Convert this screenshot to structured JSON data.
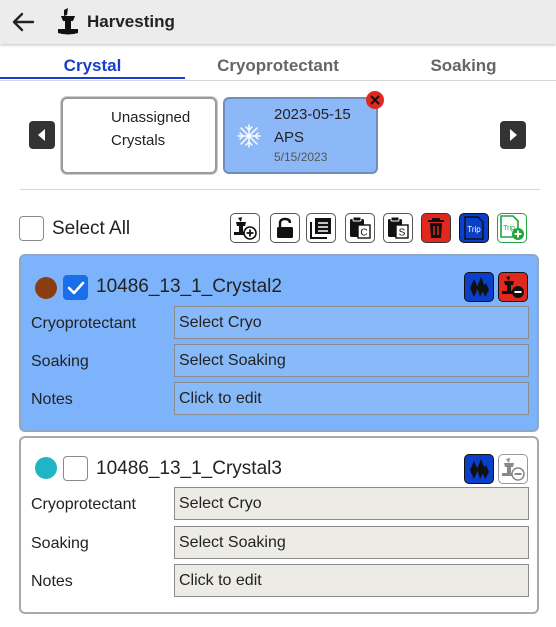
{
  "header": {
    "title": "Harvesting",
    "back_icon": "arrow-left-icon",
    "app_icon": "harvest-tool-icon"
  },
  "tabs": [
    {
      "label": "Crystal",
      "active": true
    },
    {
      "label": "Cryoprotectant",
      "active": false
    },
    {
      "label": "Soaking",
      "active": false
    }
  ],
  "trays": {
    "unassigned": {
      "line1": "Unassigned",
      "line2": "Crystals"
    },
    "selected": {
      "date": "2023-05-15",
      "location": "APS",
      "subdate": "5/15/2023",
      "icon": "snowflake-icon"
    }
  },
  "toolbar": {
    "select_all_label": "Select All",
    "tools": [
      {
        "icon": "harvest-add-icon"
      },
      {
        "icon": "lock-icon"
      },
      {
        "icon": "copy-list-icon"
      },
      {
        "icon": "clipboard-c-icon",
        "text": "C"
      },
      {
        "icon": "clipboard-s-icon",
        "text": "S"
      },
      {
        "icon": "trash-icon"
      },
      {
        "icon": "trip-icon",
        "text": "Trip"
      },
      {
        "icon": "trip-add-icon",
        "text": "Trip"
      }
    ]
  },
  "crystals": [
    {
      "name": "10486_13_1_Crystal2",
      "checked": true,
      "dot_color": "#8b3d12",
      "fields": [
        {
          "label": "Cryoprotectant",
          "value": "Select Cryo"
        },
        {
          "label": "Soaking",
          "value": "Select Soaking"
        },
        {
          "label": "Notes",
          "value": "Click to edit"
        }
      ]
    },
    {
      "name": "10486_13_1_Crystal3",
      "checked": false,
      "dot_color": "#1fb5c4",
      "fields": [
        {
          "label": "Cryoprotectant",
          "value": "Select Cryo"
        },
        {
          "label": "Soaking",
          "value": "Select Soaking"
        },
        {
          "label": "Notes",
          "value": "Click to edit"
        }
      ]
    }
  ],
  "colors": {
    "accent": "#1a3ec9",
    "selected_card": "#7db3fa",
    "danger": "#e0281f",
    "trip": "#0a3fc9",
    "trip_add": "#1fa53c"
  }
}
